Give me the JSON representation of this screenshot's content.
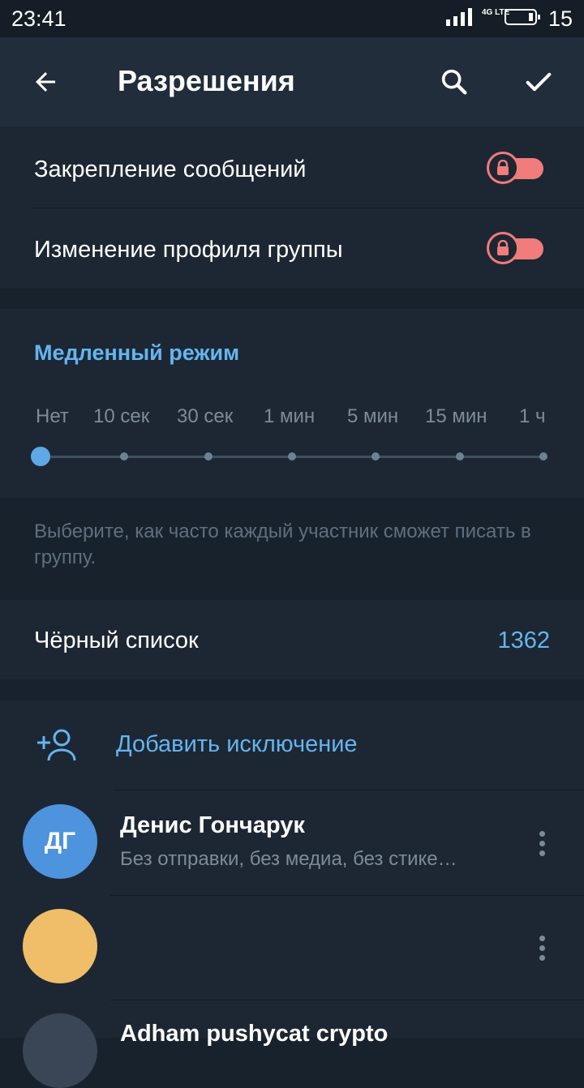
{
  "status_bar": {
    "time": "23:41",
    "network": "4G LTE",
    "battery_level": "15"
  },
  "app_bar": {
    "title": "Разрешения",
    "back_icon": "arrow-left-icon",
    "search_icon": "search-icon",
    "confirm_icon": "check-icon"
  },
  "permissions": [
    {
      "label": "Закрепление сообщений",
      "locked": true
    },
    {
      "label": "Изменение профиля группы",
      "locked": true
    }
  ],
  "slow_mode": {
    "header": "Медленный режим",
    "options": [
      "Нет",
      "10 сек",
      "30 сек",
      "1 мин",
      "5 мин",
      "15 мин",
      "1 ч"
    ],
    "selected": "Нет",
    "hint": "Выберите, как часто каждый участник сможет писать в группу."
  },
  "blacklist": {
    "label": "Чёрный список",
    "count": "1362"
  },
  "exceptions": {
    "add_label": "Добавить исключение",
    "items": [
      {
        "initials": "ДГ",
        "name": "Денис Гончарук",
        "details": "Без отправки, без медиа, без стике…",
        "avatar_color": "#4d93dd"
      },
      {
        "initials": "",
        "name": "",
        "details": "",
        "avatar_color": "#f0bd68"
      },
      {
        "initials": "",
        "name": "Adham pushycat crypto",
        "details": "",
        "avatar_color": "#3a4656"
      }
    ]
  },
  "colors": {
    "accent": "#64b5ef",
    "toggle_locked": "#f07c7c",
    "background": "#18222d",
    "section": "#1d2733"
  }
}
